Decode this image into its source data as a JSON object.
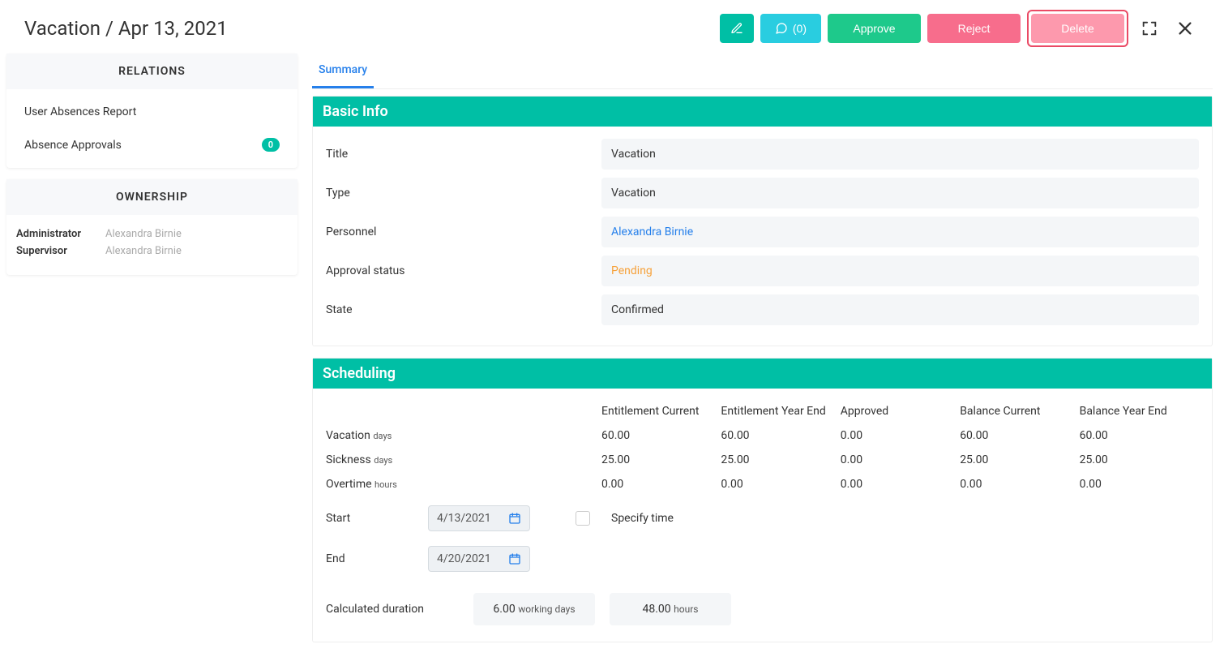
{
  "page_title": "Vacation / Apr 13, 2021",
  "toolbar": {
    "comment_label": "(0)",
    "approve_label": "Approve",
    "reject_label": "Reject",
    "delete_label": "Delete"
  },
  "tabs": {
    "summary": "Summary"
  },
  "sidebar": {
    "relations_header": "RELATIONS",
    "relations": [
      {
        "label": "User Absences Report",
        "badge": null
      },
      {
        "label": "Absence Approvals",
        "badge": "0"
      }
    ],
    "ownership_header": "OWNERSHIP",
    "ownership": [
      {
        "role": "Administrator",
        "name": "Alexandra Birnie"
      },
      {
        "role": "Supervisor",
        "name": "Alexandra Birnie"
      }
    ]
  },
  "basic_info": {
    "header": "Basic Info",
    "title_label": "Title",
    "title_value": "Vacation",
    "type_label": "Type",
    "type_value": "Vacation",
    "personnel_label": "Personnel",
    "personnel_value": "Alexandra Birnie",
    "approval_label": "Approval status",
    "approval_value": "Pending",
    "state_label": "State",
    "state_value": "Confirmed"
  },
  "scheduling": {
    "header": "Scheduling",
    "columns": {
      "c1": "Entitlement Current",
      "c2": "Entitlement Year End",
      "c3": "Approved",
      "c4": "Balance Current",
      "c5": "Balance Year End"
    },
    "rows": [
      {
        "label": "Vacation",
        "unit": "days",
        "v": [
          "60.00",
          "60.00",
          "0.00",
          "60.00",
          "60.00"
        ]
      },
      {
        "label": "Sickness",
        "unit": "days",
        "v": [
          "25.00",
          "25.00",
          "0.00",
          "25.00",
          "25.00"
        ]
      },
      {
        "label": "Overtime",
        "unit": "hours",
        "v": [
          "0.00",
          "0.00",
          "0.00",
          "0.00",
          "0.00"
        ]
      }
    ],
    "start_label": "Start",
    "start_value": "4/13/2021",
    "end_label": "End",
    "end_value": "4/20/2021",
    "specify_time_label": "Specify time",
    "calc_label": "Calculated duration",
    "calc_days_value": "6.00",
    "calc_days_unit": "working days",
    "calc_hours_value": "48.00",
    "calc_hours_unit": "hours"
  }
}
